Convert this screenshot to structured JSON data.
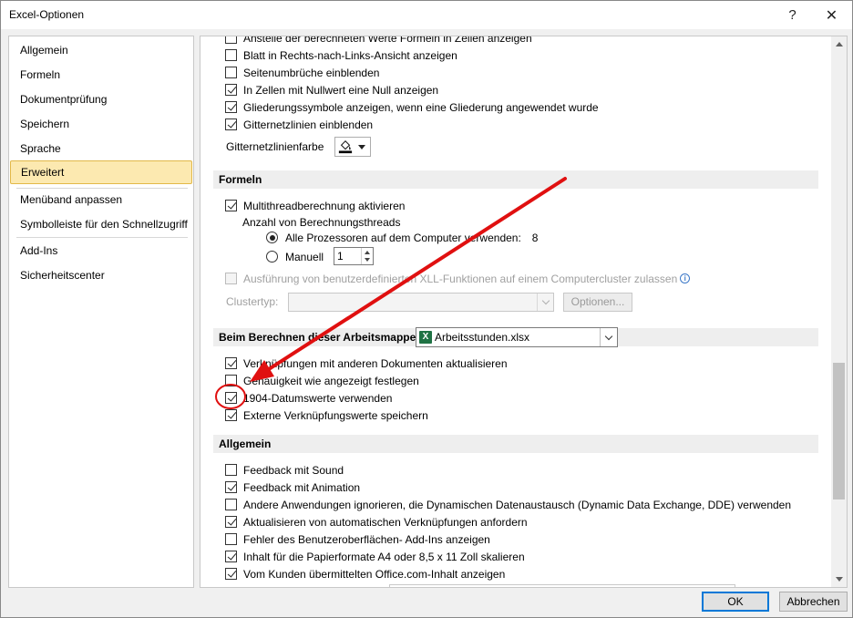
{
  "window": {
    "title": "Excel-Optionen",
    "help_glyph": "?",
    "close_glyph": "✕"
  },
  "sidebar": {
    "items": [
      {
        "label": "Allgemein"
      },
      {
        "label": "Formeln"
      },
      {
        "label": "Dokumentprüfung"
      },
      {
        "label": "Speichern"
      },
      {
        "label": "Sprache"
      },
      {
        "label": "Erweitert",
        "selected": true
      },
      {
        "label": "Menüband anpassen"
      },
      {
        "label": "Symbolleiste für den Schnellzugriff"
      },
      {
        "label": "Add-Ins"
      },
      {
        "label": "Sicherheitscenter"
      }
    ]
  },
  "display_options": [
    {
      "label": "Anstelle der berechneten Werte Formeln in Zellen anzeigen",
      "checked": false
    },
    {
      "label": "Blatt in Rechts-nach-Links-Ansicht anzeigen",
      "checked": false
    },
    {
      "label": "Seitenumbrüche einblenden",
      "checked": false
    },
    {
      "label": "In Zellen mit Nullwert eine Null anzeigen",
      "checked": true
    },
    {
      "label": "Gliederungssymbole anzeigen, wenn eine Gliederung angewendet wurde",
      "checked": true
    },
    {
      "label": "Gitternetzlinien einblenden",
      "checked": true
    }
  ],
  "gridline_color": {
    "label": "Gitternetzlinienfarbe",
    "icon": "paint-bucket-icon"
  },
  "formulas": {
    "heading": "Formeln",
    "multithread": {
      "label": "Multithreadberechnung aktivieren",
      "checked": true
    },
    "threads_label": "Anzahl von Berechnungsthreads",
    "all_processors": {
      "label": "Alle Prozessoren auf dem Computer verwenden:",
      "value": "8",
      "selected": true
    },
    "manual": {
      "label": "Manuell",
      "value": "1",
      "selected": false
    },
    "xll": {
      "label": "Ausführung von benutzerdefinierten XLL-Funktionen auf einem Computercluster zulassen",
      "checked": false,
      "disabled": true
    },
    "cluster_type_label": "Clustertyp:",
    "options_button": "Optionen..."
  },
  "workbook_calc": {
    "heading": "Beim Berechnen dieser Arbeitsmappe:",
    "workbook": "Arbeitsstunden.xlsx",
    "options": [
      {
        "label": "Verknüpfungen mit anderen Dokumenten aktualisieren",
        "checked": true
      },
      {
        "label": "Genauigkeit wie angezeigt festlegen",
        "checked": false
      },
      {
        "label": "1904-Datumswerte verwenden",
        "checked": true
      },
      {
        "label": "Externe Verknüpfungswerte speichern",
        "checked": true
      }
    ]
  },
  "general": {
    "heading": "Allgemein",
    "options": [
      {
        "label": "Feedback mit Sound",
        "checked": false
      },
      {
        "label": "Feedback mit Animation",
        "checked": true
      },
      {
        "label": "Andere Anwendungen ignorieren, die Dynamischen Datenaustausch (Dynamic Data Exchange, DDE) verwenden",
        "checked": false
      },
      {
        "label": "Aktualisieren von automatischen Verknüpfungen anfordern",
        "checked": true
      },
      {
        "label": "Fehler des Benutzeroberflächen- Add-Ins anzeigen",
        "checked": false
      },
      {
        "label": "Inhalt für die Papierformate A4 oder 8,5 x 11 Zoll skalieren",
        "checked": true
      },
      {
        "label": "Vom Kunden übermittelten Office.com-Inhalt anzeigen",
        "checked": true
      }
    ]
  },
  "footer": {
    "ok": "OK",
    "cancel": "Abbrechen"
  },
  "annotation": {
    "color": "#e01010"
  }
}
